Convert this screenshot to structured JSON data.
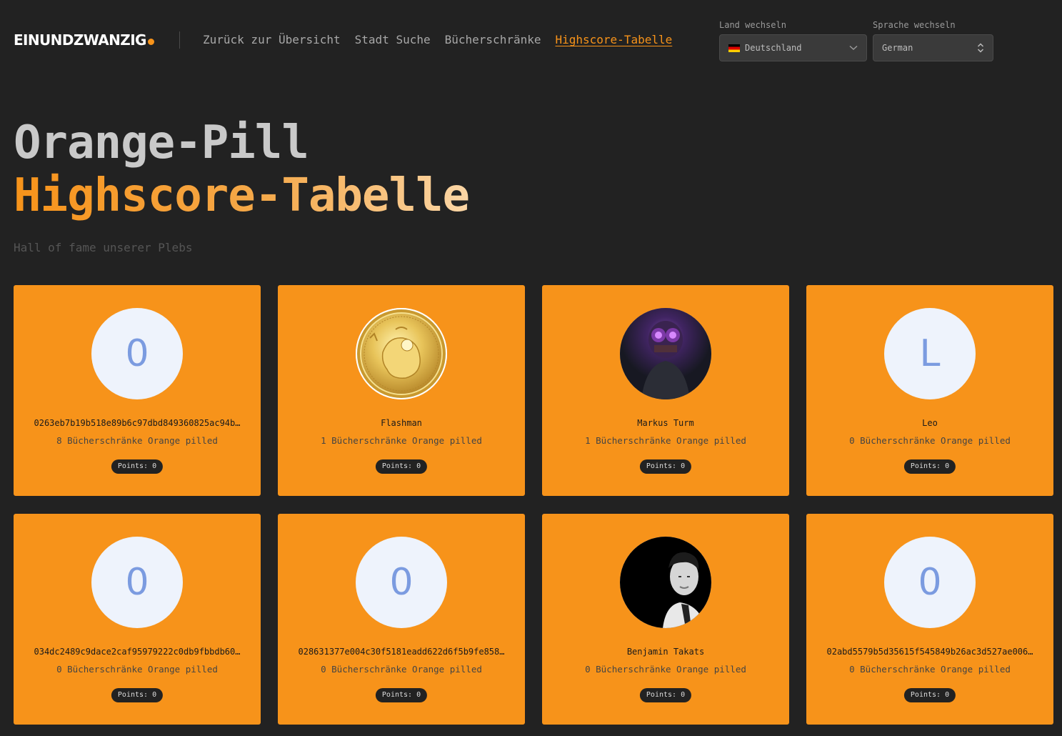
{
  "header": {
    "logo_text": "EINUNDZWANZIG",
    "nav": [
      {
        "label": "Zurück zur Übersicht",
        "active": false
      },
      {
        "label": "Stadt Suche",
        "active": false
      },
      {
        "label": "Bücherschränke",
        "active": false
      },
      {
        "label": "Highscore-Tabelle",
        "active": true
      }
    ],
    "country": {
      "label": "Land wechseln",
      "value": "Deutschland"
    },
    "language": {
      "label": "Sprache wechseln",
      "value": "German"
    }
  },
  "hero": {
    "title_line1": "Orange-Pill",
    "title_line2": "Highscore-Tabelle",
    "subtitle": "Hall of fame unserer Plebs"
  },
  "cards": [
    {
      "avatar": "initial",
      "initial": "0",
      "name": "0263eb7b19b518e89b6c97dbd849360825ac94b…",
      "count": "8 Bücherschränke Orange pilled",
      "points": "Points: 0"
    },
    {
      "avatar": "gold-coin-image",
      "name": "Flashman",
      "count": "1 Bücherschränke Orange pilled",
      "points": "Points: 0"
    },
    {
      "avatar": "neon-mask-photo",
      "name": "Markus Turm",
      "count": "1 Bücherschränke Orange pilled",
      "points": "Points: 0"
    },
    {
      "avatar": "initial",
      "initial": "L",
      "name": "Leo",
      "count": "0 Bücherschränke Orange pilled",
      "points": "Points: 0"
    },
    {
      "avatar": "initial",
      "initial": "0",
      "name": "034dc2489c9dace2caf95979222c0db9fbbdb60…",
      "count": "0 Bücherschränke Orange pilled",
      "points": "Points: 0"
    },
    {
      "avatar": "initial",
      "initial": "0",
      "name": "028631377e004c30f5181eadd622d6f5b9fe858…",
      "count": "0 Bücherschränke Orange pilled",
      "points": "Points: 0"
    },
    {
      "avatar": "portrait-photo",
      "name": "Benjamin Takats",
      "count": "0 Bücherschränke Orange pilled",
      "points": "Points: 0"
    },
    {
      "avatar": "initial",
      "initial": "0",
      "name": "02abd5579b5d35615f545849b26ac3d527ae006…",
      "count": "0 Bücherschränke Orange pilled",
      "points": "Points: 0"
    }
  ],
  "colors": {
    "accent": "#f7931a",
    "background": "#222222",
    "avatar_bg": "#eef3fc",
    "avatar_initial": "#7b9be0"
  }
}
